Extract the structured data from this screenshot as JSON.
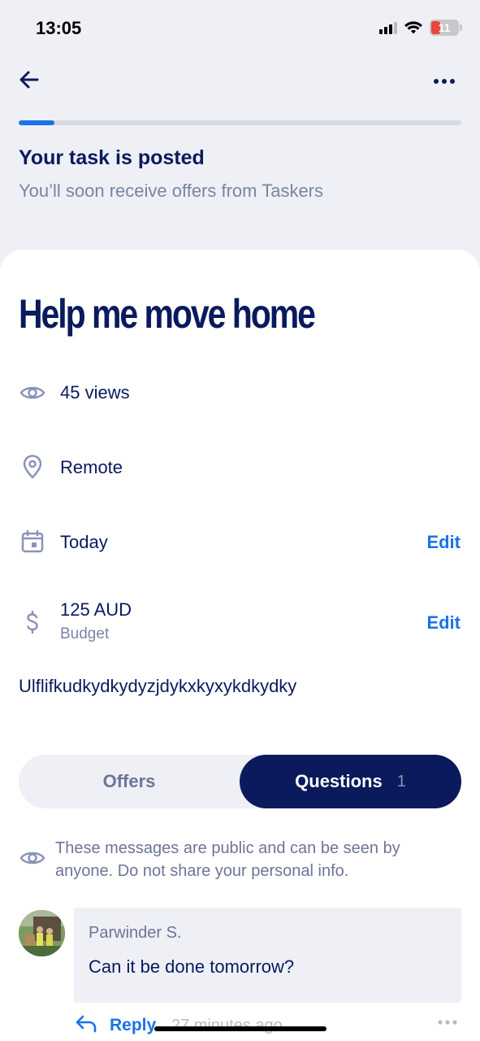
{
  "status_bar": {
    "time": "13:05",
    "battery_level": "11"
  },
  "header": {
    "back_icon": "arrow-left-icon",
    "more_icon": "more-horizontal-icon"
  },
  "progress": {
    "fraction": 0.08
  },
  "banner": {
    "title": "Your task is posted",
    "subtitle": "You’ll soon receive offers from Taskers"
  },
  "task": {
    "title": "Help me move home",
    "views": "45 views",
    "location": "Remote",
    "date": "Today",
    "date_edit": "Edit",
    "budget": "125 AUD",
    "budget_label": "Budget",
    "budget_edit": "Edit",
    "description": "Ulflifkudkydkydyzjdykxkyxykdkydky"
  },
  "tabs": {
    "offers": "Offers",
    "questions": "Questions",
    "questions_count": "1"
  },
  "notice": "These messages are public and can be seen by anyone. Do not share your personal info.",
  "question": {
    "author": "Parwinder  S.",
    "message": "Can it be done tomorrow?",
    "reply_label": "Reply",
    "time": "27 minutes ago"
  },
  "colors": {
    "navy": "#0a1a5c",
    "accent_blue": "#1a73e8",
    "muted": "#7b84a6",
    "surface": "#eef0f6"
  }
}
